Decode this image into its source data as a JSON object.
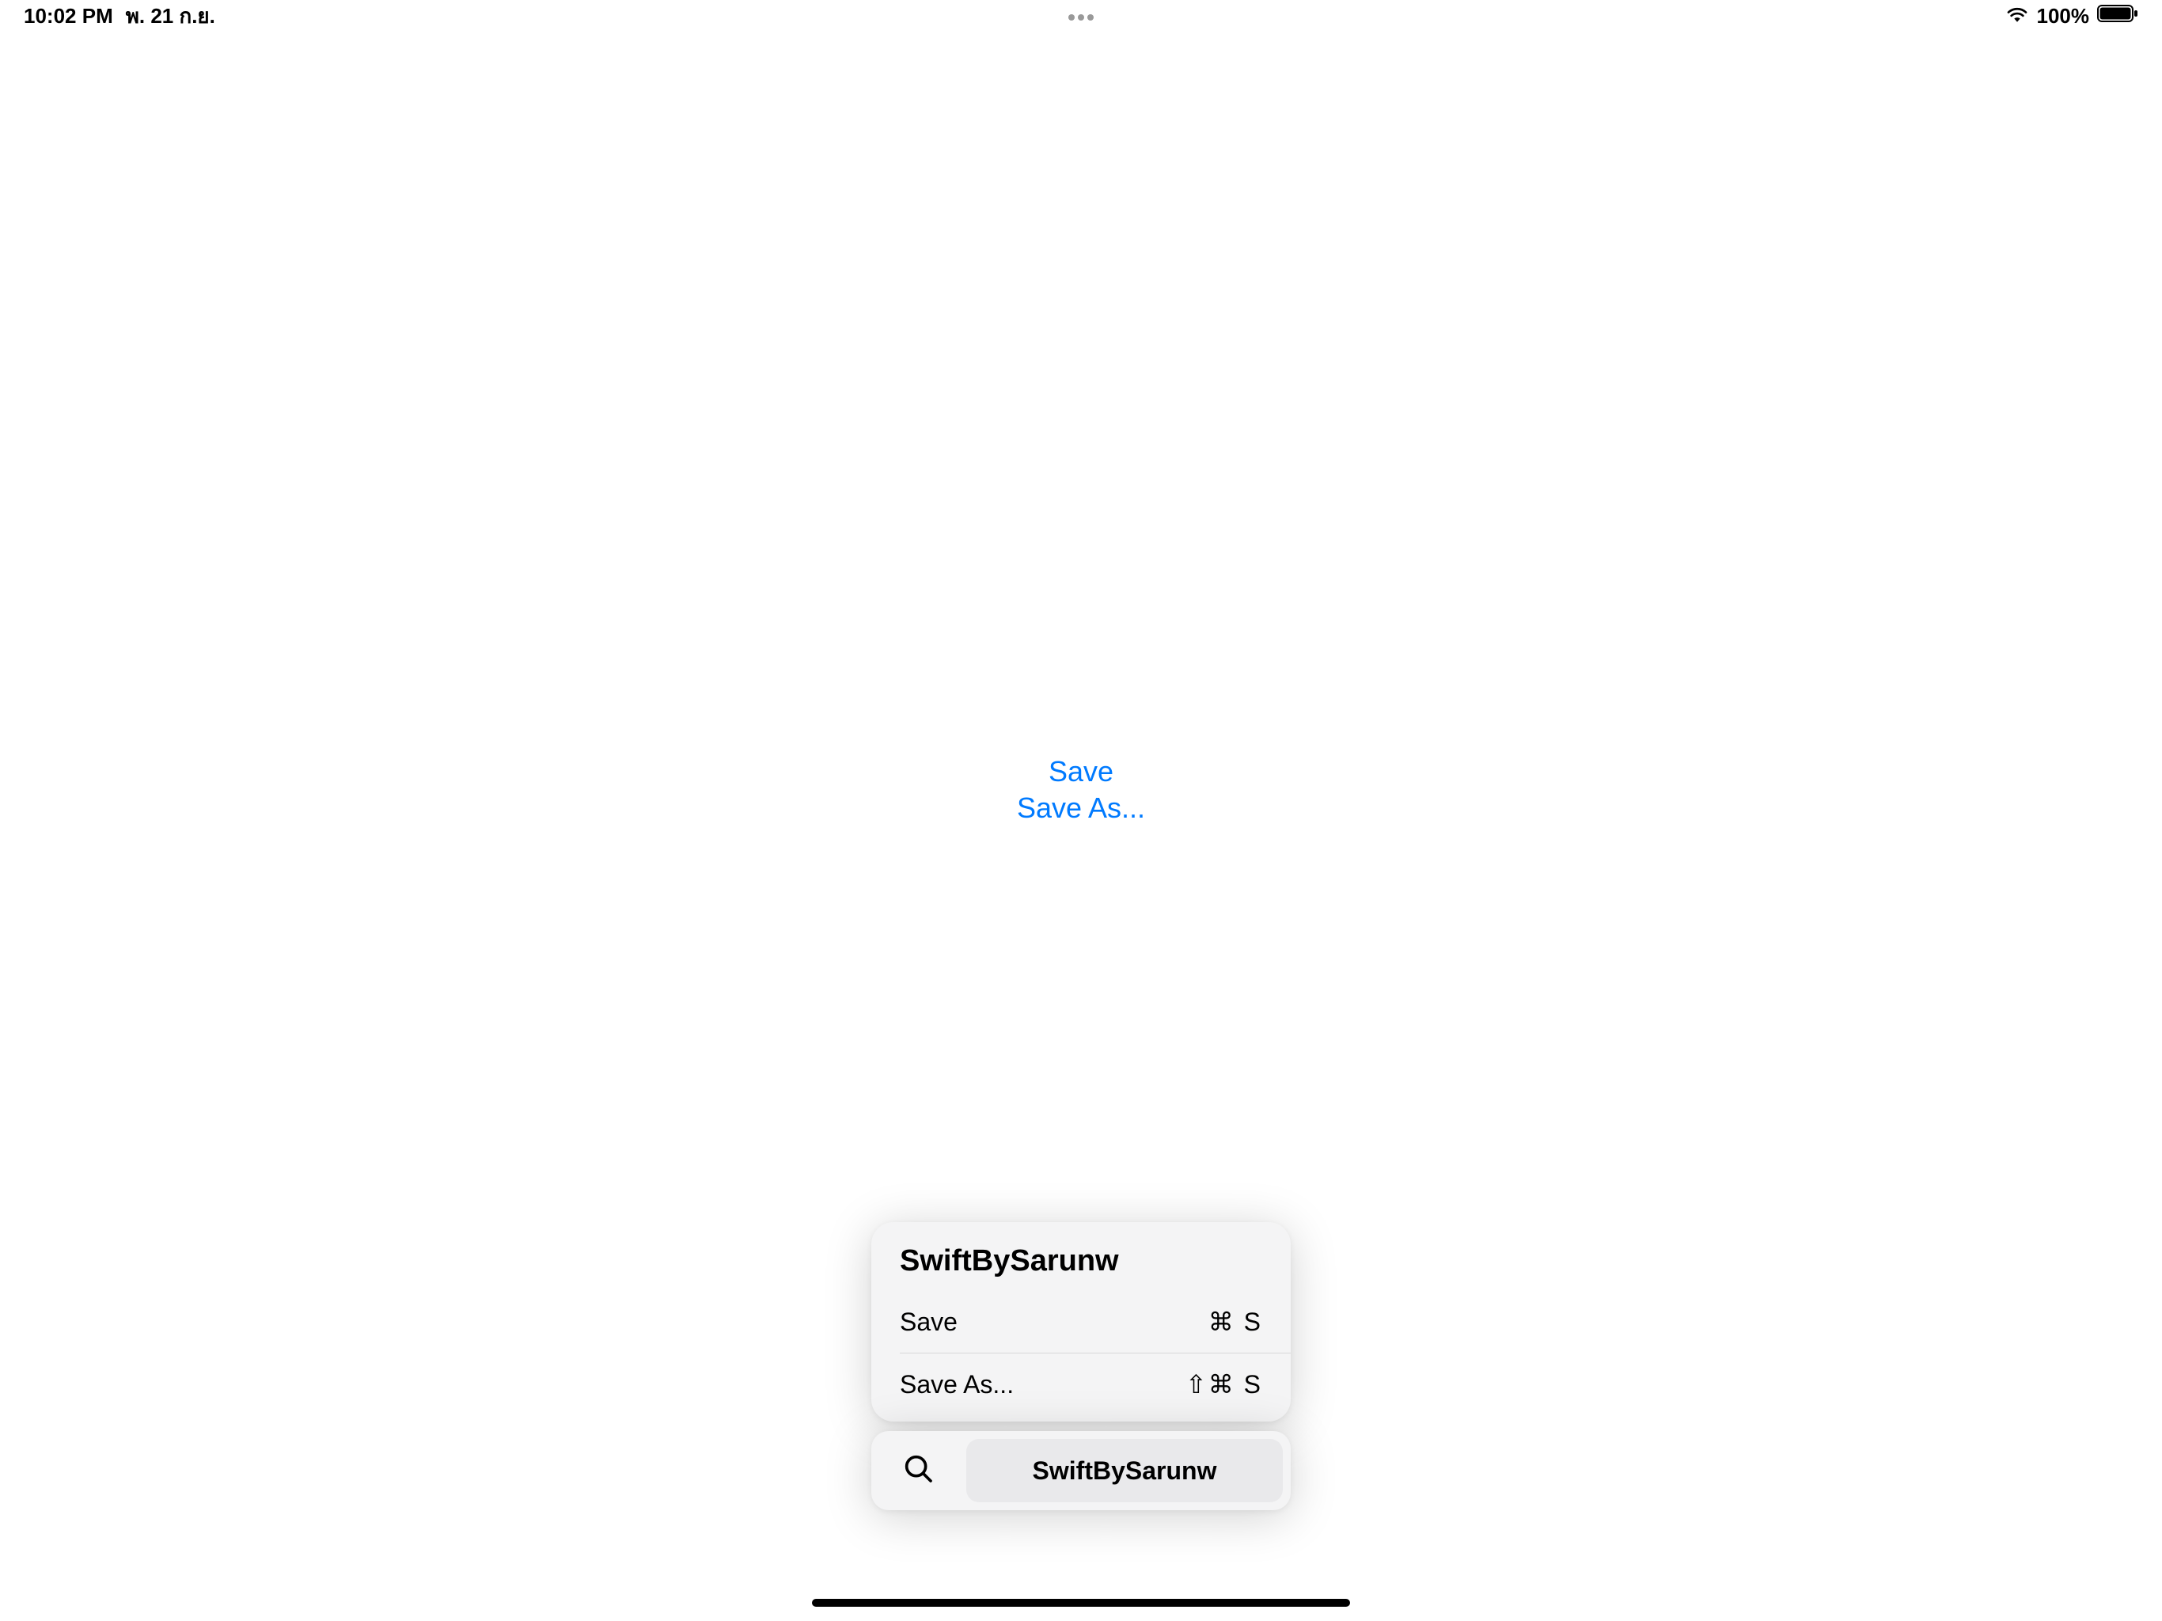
{
  "status": {
    "time": "10:02 PM",
    "date": "พ. 21 ก.ย.",
    "battery": "100%"
  },
  "center": {
    "save": "Save",
    "save_as": "Save As..."
  },
  "panel": {
    "title": "SwiftBySarunw",
    "items": [
      {
        "label": "Save",
        "shortcut": "⌘ S"
      },
      {
        "label": "Save As...",
        "shortcut": "⇧⌘ S"
      }
    ]
  },
  "bar": {
    "tab": "SwiftBySarunw"
  }
}
